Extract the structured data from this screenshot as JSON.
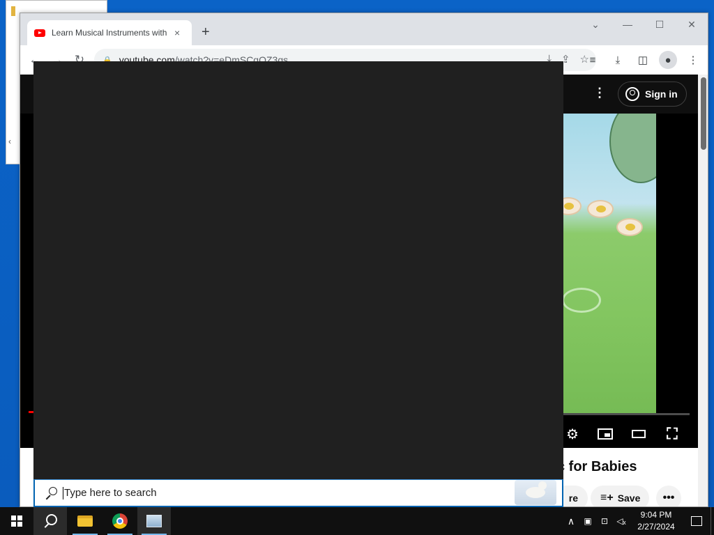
{
  "browser": {
    "tab_title": "Learn Musical Instruments with T",
    "tab_close": "×",
    "new_tab": "+",
    "url_host": "youtube.com",
    "url_path": "/watch?v=eDmSCqOZ3qs",
    "window_controls": {
      "minimize": "—",
      "maximize": "☐",
      "close": "✕",
      "tablist": "⌄"
    }
  },
  "youtube": {
    "sign_in_label": "Sign in",
    "video_title_partial": "c for Babies",
    "share_label_partial": "re",
    "save_label": "Save",
    "more_label": "•••"
  },
  "search": {
    "placeholder": "Type here to search"
  },
  "taskbar": {
    "time": "9:04 PM",
    "date": "2/27/2024"
  },
  "colors": {
    "youtube_red": "#ff0000",
    "search_accent": "#0063b1",
    "taskbar": "#101010"
  }
}
